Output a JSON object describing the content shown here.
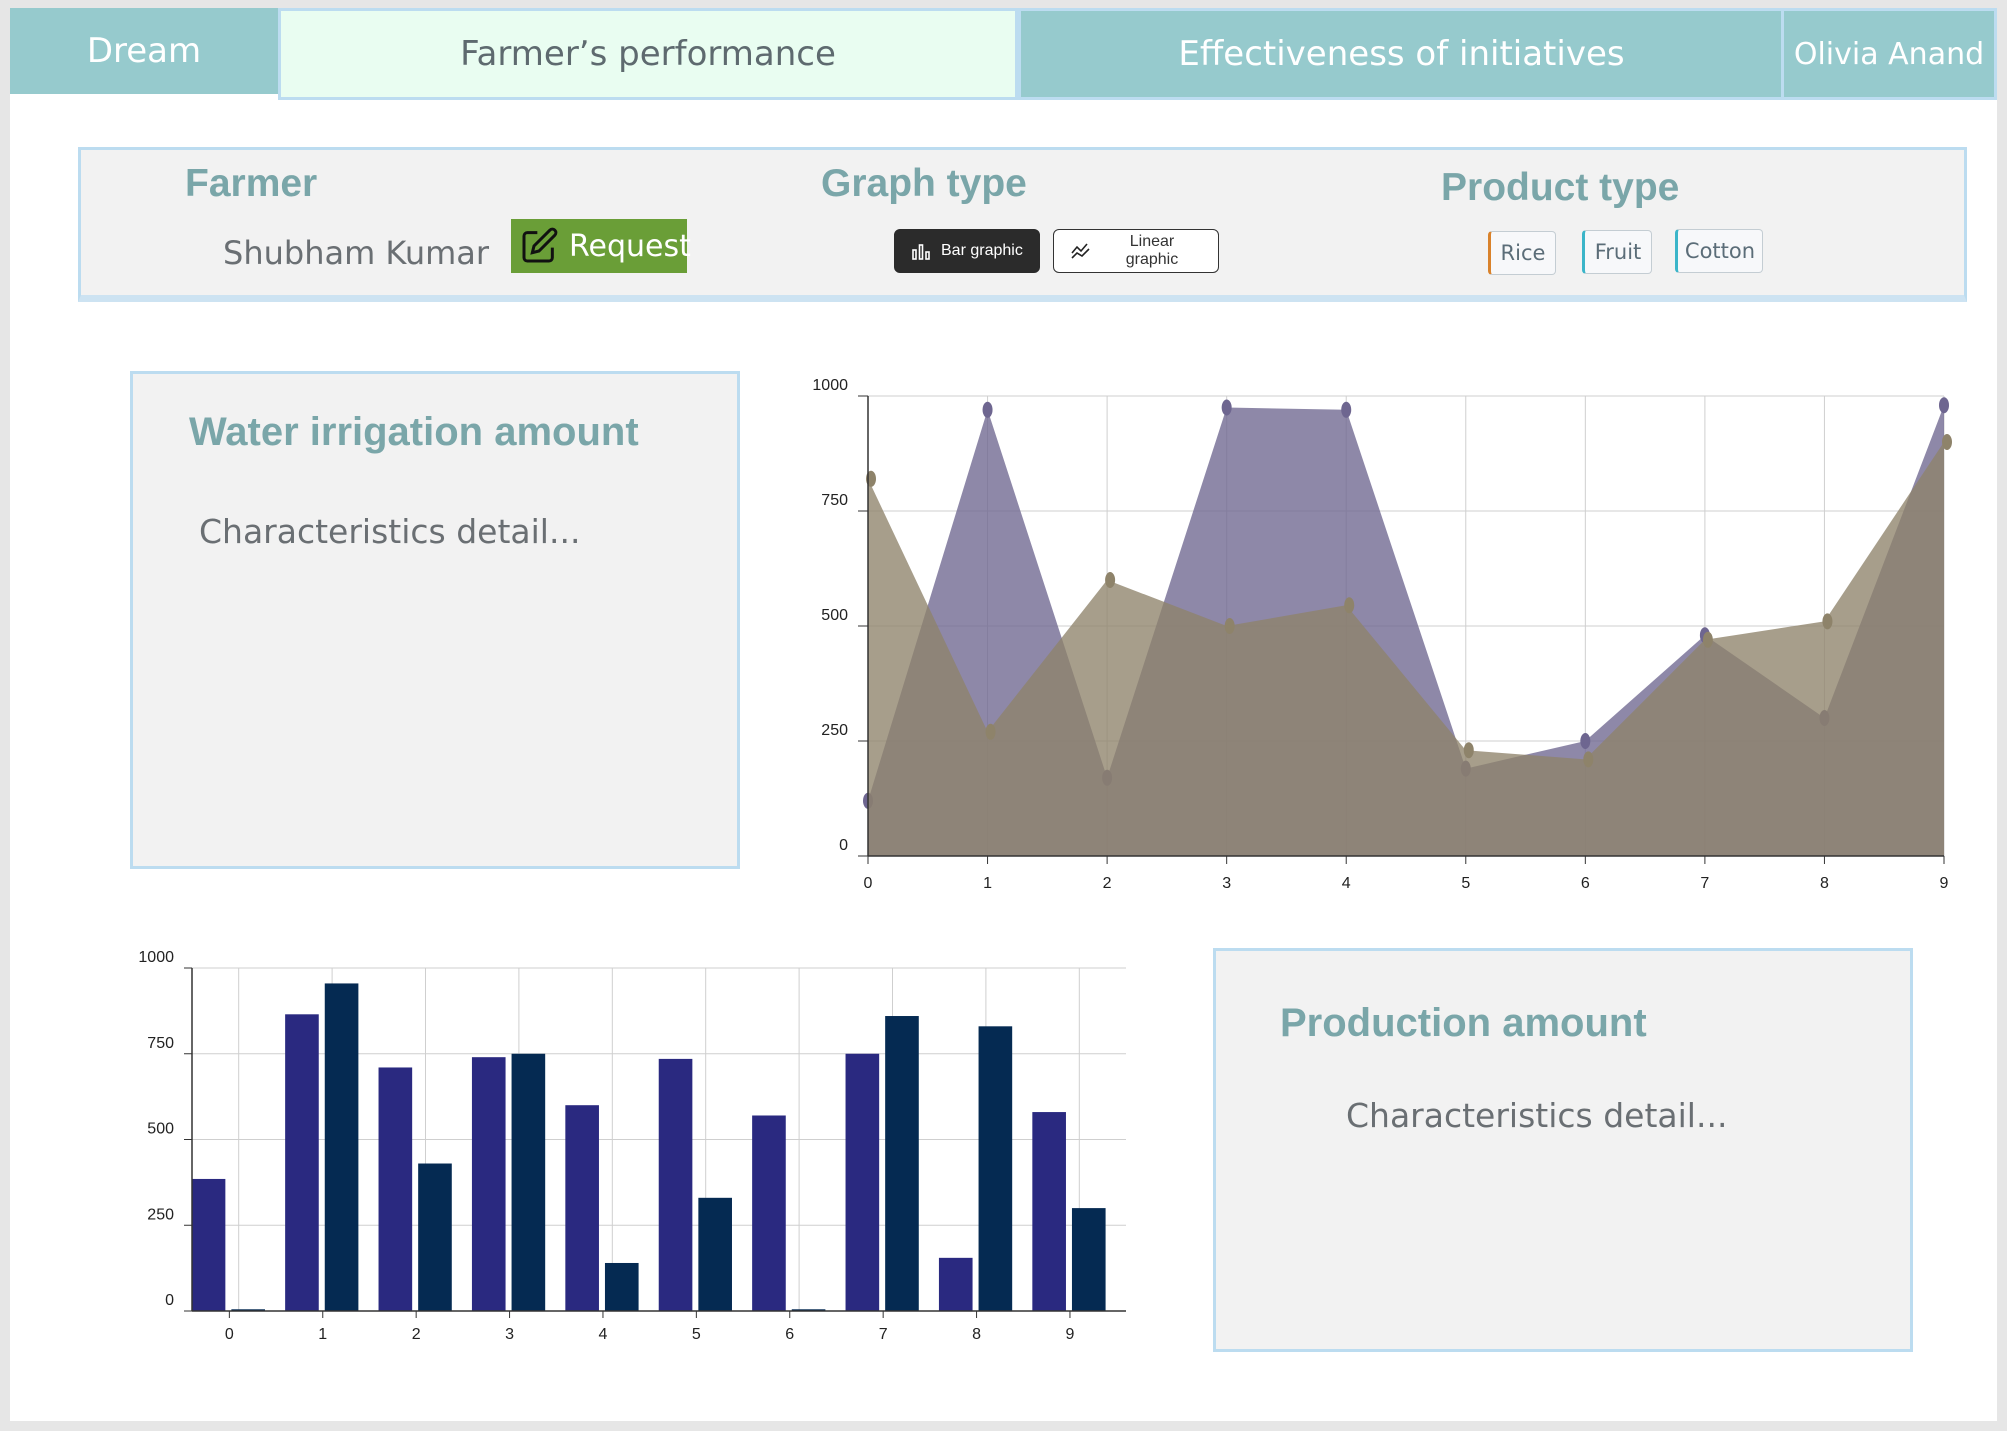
{
  "tabs": {
    "dream": "Dream",
    "performance": "Farmer’s performance",
    "effectiveness": "Effectiveness of initiatives",
    "user": "Olivia Anand"
  },
  "filters": {
    "farmer_title": "Farmer",
    "farmer_name": "Shubham Kumar",
    "request_label": "Request",
    "graph_title": "Graph type",
    "bar_label": "Bar graphic",
    "line_label": "Linear graphic",
    "product_title": "Product type",
    "products": [
      "Rice",
      "Fruit",
      "Cotton"
    ],
    "product_accents": [
      "#d9822b",
      "#3bb5c9",
      "#3bb5c9"
    ]
  },
  "water_card": {
    "title": "Water irrigation amount",
    "detail": "Characteristics detail..."
  },
  "production_card": {
    "title": "Production amount",
    "detail": "Characteristics detail..."
  },
  "colors": {
    "teal_tab": "#96cacd",
    "active_tab": "#e9fdf1",
    "request_green": "#6a9e37",
    "card_title": "#7aa6a9",
    "panel_border": "#bcdcf0"
  },
  "chart_data": [
    {
      "type": "area",
      "x": [
        0,
        1,
        2,
        3,
        4,
        5,
        6,
        7,
        8,
        9
      ],
      "series": [
        {
          "values": [
            120,
            970,
            170,
            975,
            970,
            190,
            250,
            480,
            300,
            980
          ],
          "color": "#6e6690"
        },
        {
          "values": [
            820,
            270,
            600,
            500,
            545,
            230,
            210,
            470,
            510,
            900
          ],
          "color": "#8e836a"
        }
      ],
      "yticks": [
        0,
        250,
        500,
        750,
        1000
      ],
      "ylim": [
        0,
        1000
      ],
      "grid": true
    },
    {
      "type": "bar",
      "categories": [
        "0",
        "1",
        "2",
        "3",
        "4",
        "5",
        "6",
        "7",
        "8",
        "9"
      ],
      "series": [
        {
          "values": [
            385,
            865,
            710,
            740,
            600,
            735,
            570,
            750,
            155,
            580
          ],
          "color": "#2a2980"
        },
        {
          "values": [
            5,
            955,
            430,
            750,
            140,
            330,
            5,
            860,
            830,
            300
          ],
          "color": "#052a52"
        }
      ],
      "yticks": [
        0,
        250,
        500,
        750,
        1000
      ],
      "ylim": [
        0,
        1000
      ],
      "grid": true
    }
  ]
}
